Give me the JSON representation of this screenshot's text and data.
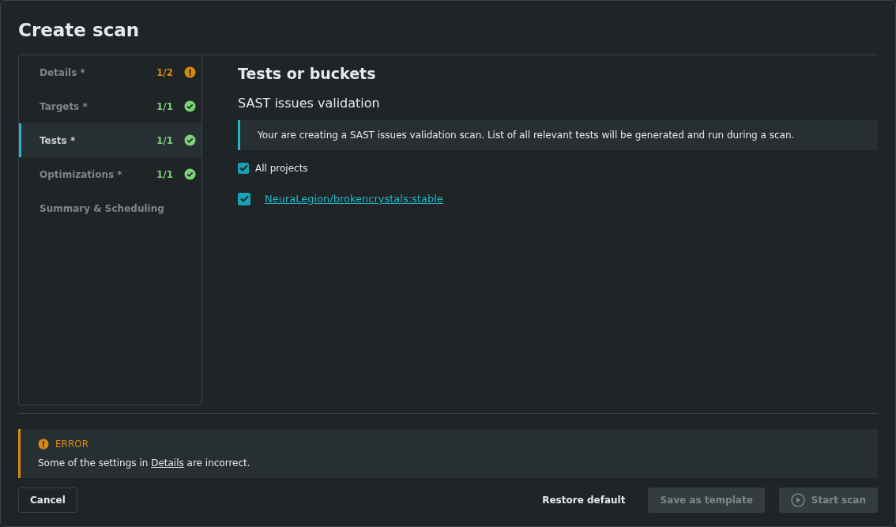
{
  "window": {
    "title": "Create scan"
  },
  "steps": [
    {
      "label": "Details *",
      "count": "1/2",
      "kind": "warning",
      "selected": false
    },
    {
      "label": "Targets *",
      "count": "1/1",
      "kind": "done",
      "selected": false
    },
    {
      "label": "Tests *",
      "count": "1/1",
      "kind": "done",
      "selected": true
    },
    {
      "label": "Optimizations *",
      "count": "1/1",
      "kind": "done",
      "selected": false
    },
    {
      "label": "Summary & Scheduling",
      "kind": "plain",
      "selected": false
    }
  ],
  "content": {
    "heading": "Tests or buckets",
    "subheading": "SAST issues validation",
    "info": "Your are creating a SAST issues validation scan. List of all relevant tests will be generated and run during a scan.",
    "all_projects": {
      "label": "All projects",
      "checked": true
    },
    "projects": [
      {
        "label": "NeuraLegion/brokencrystals:stable",
        "checked": true
      }
    ]
  },
  "error": {
    "title": "ERROR",
    "text_before": "Some of the settings in ",
    "link": "Details",
    "text_after": " are incorrect."
  },
  "footer": {
    "cancel": "Cancel",
    "restore": "Restore default",
    "save_template": {
      "label": "Save as template",
      "disabled": true
    },
    "start_scan": {
      "label": "Start scan",
      "disabled": true
    }
  }
}
